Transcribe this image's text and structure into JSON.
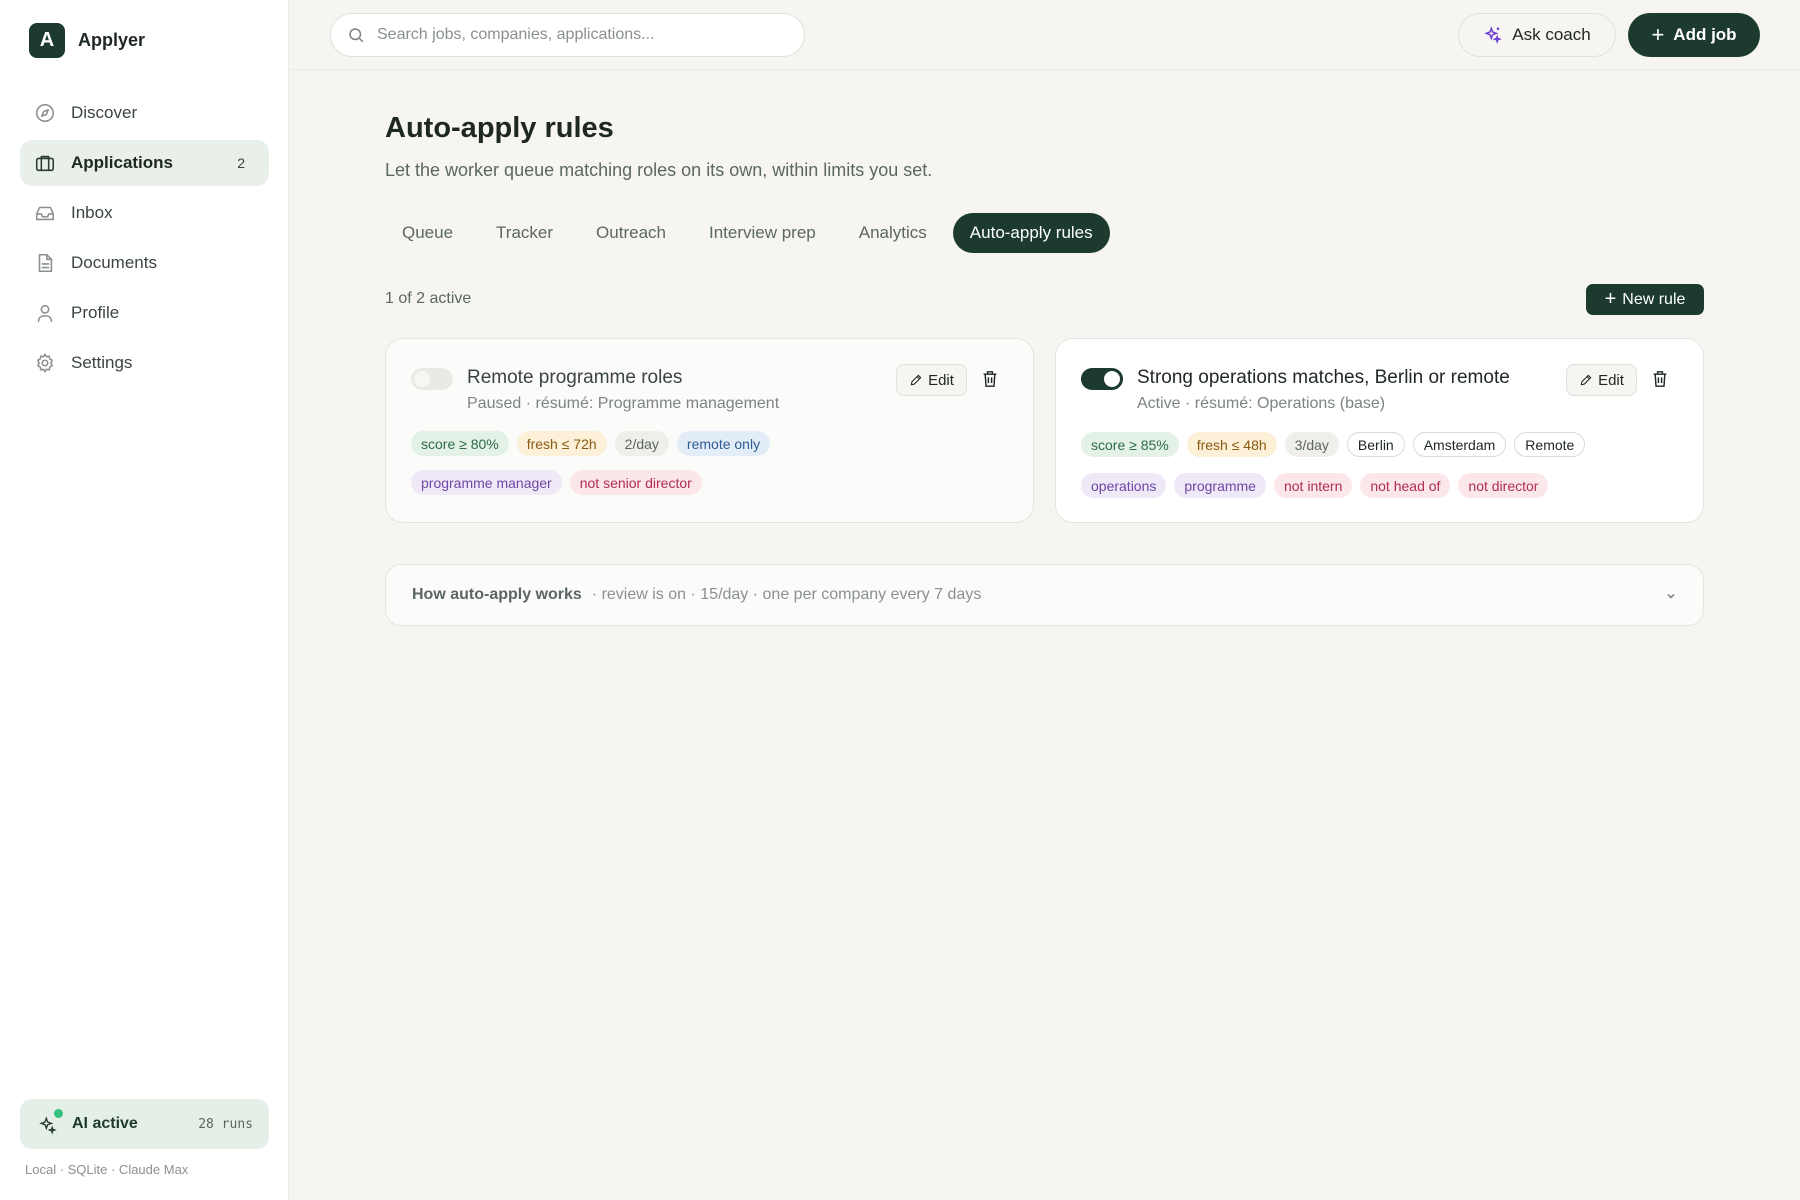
{
  "app": {
    "brand_initial": "A",
    "brand_name": "Applyer"
  },
  "sidebar": {
    "items": [
      {
        "label": "Discover",
        "icon": "compass-icon"
      },
      {
        "label": "Applications",
        "icon": "briefcase-icon",
        "count": "2",
        "active": true
      },
      {
        "label": "Inbox",
        "icon": "inbox-icon"
      },
      {
        "label": "Documents",
        "icon": "document-icon"
      },
      {
        "label": "Profile",
        "icon": "user-icon"
      },
      {
        "label": "Settings",
        "icon": "gear-icon"
      }
    ],
    "ai_status": {
      "label": "AI active",
      "runs": "28 runs",
      "indicator_color": "#34c27a"
    },
    "footer": "Local · SQLite · Claude Max"
  },
  "topbar": {
    "search_placeholder": "Search jobs, companies, applications...",
    "ask_coach": "Ask coach",
    "add_job": "Add job"
  },
  "page": {
    "title": "Auto-apply rules",
    "subtitle": "Let the worker queue matching roles on its own, within limits you set.",
    "tabs": [
      {
        "label": "Queue"
      },
      {
        "label": "Tracker"
      },
      {
        "label": "Outreach"
      },
      {
        "label": "Interview prep"
      },
      {
        "label": "Analytics"
      },
      {
        "label": "Auto-apply rules",
        "active": true
      }
    ],
    "active_count": "1 of 2 active",
    "new_rule": "New rule"
  },
  "rules": [
    {
      "title": "Remote programme roles",
      "meta": "Paused · résumé: Programme management",
      "enabled": false,
      "edit_label": "Edit",
      "tags_row1": [
        {
          "text": "score ≥ 80%",
          "kind": "green"
        },
        {
          "text": "fresh ≤ 72h",
          "kind": "amber"
        },
        {
          "text": "2/day",
          "kind": "gray"
        },
        {
          "text": "remote only",
          "kind": "blue"
        }
      ],
      "tags_row2": [
        {
          "text": "programme manager",
          "kind": "purple"
        },
        {
          "text": "not senior director",
          "kind": "red"
        }
      ]
    },
    {
      "title": "Strong operations matches, Berlin or remote",
      "meta": "Active · résumé: Operations (base)",
      "enabled": true,
      "edit_label": "Edit",
      "tags_row1": [
        {
          "text": "score ≥ 85%",
          "kind": "green"
        },
        {
          "text": "fresh ≤ 48h",
          "kind": "amber"
        },
        {
          "text": "3/day",
          "kind": "gray"
        },
        {
          "text": "Berlin",
          "kind": "outline"
        },
        {
          "text": "Amsterdam",
          "kind": "outline"
        },
        {
          "text": "Remote",
          "kind": "outline"
        }
      ],
      "tags_row2": [
        {
          "text": "operations",
          "kind": "purple"
        },
        {
          "text": "programme",
          "kind": "purple"
        },
        {
          "text": "not intern",
          "kind": "red"
        },
        {
          "text": "not head of",
          "kind": "red"
        },
        {
          "text": "not director",
          "kind": "red"
        }
      ]
    }
  ],
  "howto": {
    "title": "How auto-apply works",
    "meta": "· review is on · 15/day · one per company every 7 days"
  },
  "colors": {
    "primary": "#1c3a2e",
    "background": "#f6f5f1",
    "accent_ai": "#6d3fd6"
  }
}
